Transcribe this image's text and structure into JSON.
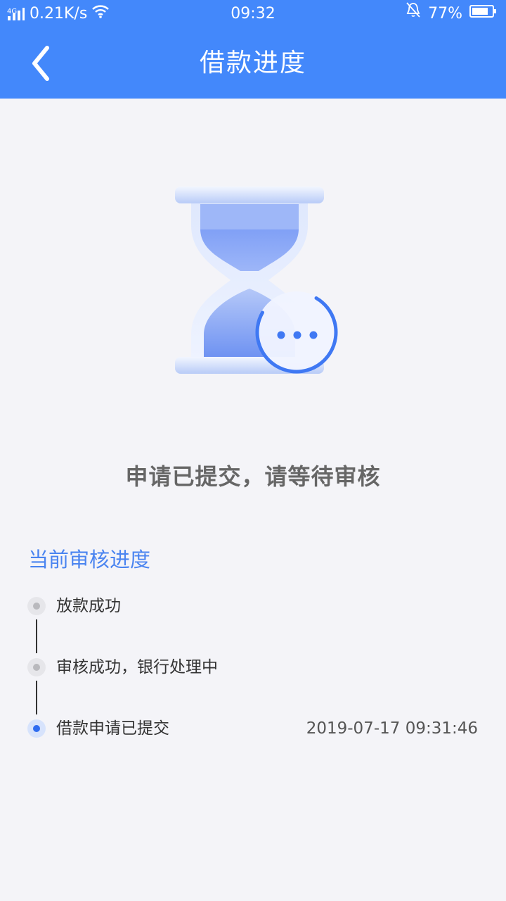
{
  "status_bar": {
    "network_type": "4G",
    "speed": "0.21K/s",
    "time": "09:32",
    "battery": "77%"
  },
  "header": {
    "title": "借款进度"
  },
  "main": {
    "status_message": "申请已提交，请等待审核",
    "progress_title": "当前审核进度",
    "steps": [
      {
        "label": "放款成功",
        "time": "",
        "state": "pending"
      },
      {
        "label": "审核成功，银行处理中",
        "time": "",
        "state": "pending"
      },
      {
        "label": "借款申请已提交",
        "time": "2019-07-17 09:31:46",
        "state": "active"
      }
    ]
  },
  "colors": {
    "brand": "#4388fb",
    "accent_text": "#4a84f0",
    "pending_dot": "#bbbbbb",
    "active_dot": "#2f6cf0"
  }
}
